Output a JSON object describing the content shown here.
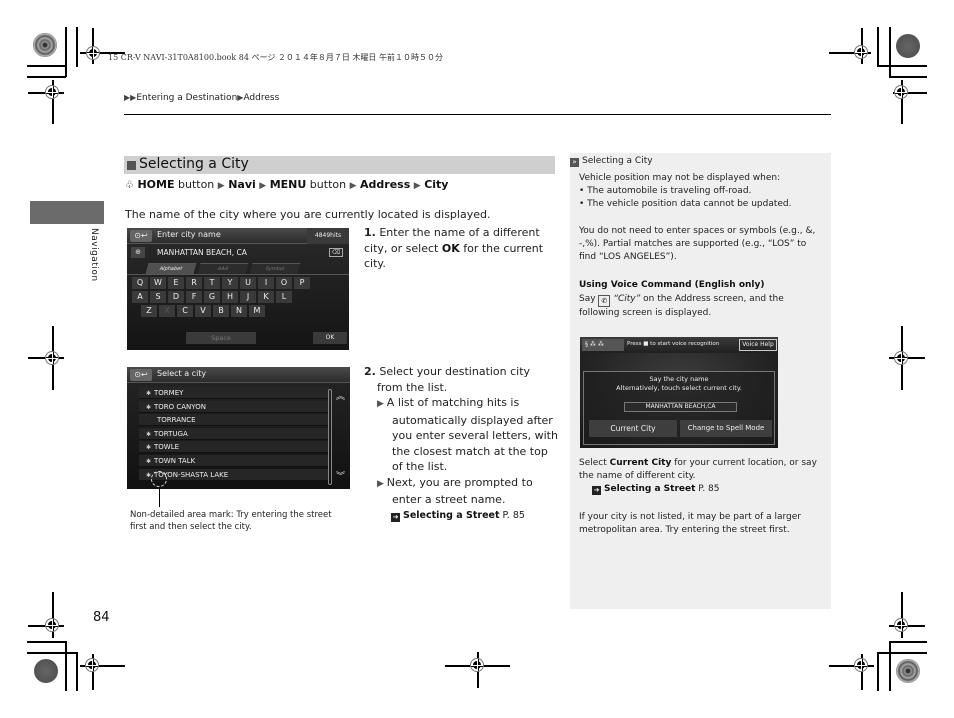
{
  "print_header": "15 CR-V NAVI-31T0A8100.book  84 ページ  ２０１４年８月７日  木曜日  午前１０時５０分",
  "breadcrumb": [
    "Entering a Destination",
    "Address"
  ],
  "side_tab_label": "Navigation",
  "section_title": "Selecting a City",
  "menu_path": [
    {
      "text": "HOME",
      "bold": true
    },
    {
      "text": " button ",
      "bold": false
    },
    {
      "text": "Navi",
      "bold": true
    },
    {
      "text": "MENU",
      "bold": true
    },
    {
      "text": " button ",
      "bold": false
    },
    {
      "text": "Address",
      "bold": true
    },
    {
      "text": "City",
      "bold": true
    }
  ],
  "intro_text": "The name of the city where you are currently located is displayed.",
  "screen_enter_city": {
    "title": "Enter city name",
    "hits": "4849hits",
    "city_value": "MANHATTAN BEACH, CA",
    "tabs": [
      "Alphabet",
      "AAA",
      "Symbol"
    ],
    "keys_row1": [
      "Q",
      "W",
      "E",
      "R",
      "T",
      "Y",
      "U",
      "I",
      "O",
      "P"
    ],
    "keys_row2": [
      "A",
      "S",
      "D",
      "F",
      "G",
      "H",
      "J",
      "K",
      "L"
    ],
    "keys_row3": [
      "Z",
      "X",
      "C",
      "V",
      "B",
      "N",
      "M"
    ],
    "space_label": "Space",
    "ok_label": "OK"
  },
  "screen_select_city": {
    "title": "Select a city",
    "items": [
      {
        "name": "TORMEY",
        "non_detailed": true
      },
      {
        "name": "TORO CANYON",
        "non_detailed": true
      },
      {
        "name": "TORRANCE",
        "non_detailed": false
      },
      {
        "name": "TORTUGA",
        "non_detailed": true
      },
      {
        "name": "TOWLE",
        "non_detailed": true
      },
      {
        "name": "TOWN TALK",
        "non_detailed": true
      },
      {
        "name": "TOYON-SHASTA LAKE",
        "non_detailed": true
      }
    ]
  },
  "caption": "Non-detailed area mark: Try entering the street first and then select the city.",
  "step1": {
    "num": "1.",
    "text_a": "Enter the name of a different city, or select ",
    "bold": "OK",
    "text_b": " for the current city."
  },
  "step2": {
    "num": "2.",
    "text": "Select your destination city from the list.",
    "bullets": [
      "A list of matching hits is automatically displayed after you enter several letters, with the closest match at the top of the list.",
      "Next, you are prompted to enter a street name."
    ],
    "ref_label": "Selecting a Street",
    "ref_page": "P. 85"
  },
  "notes": {
    "header": "Selecting a City",
    "p1": "Vehicle position may not be displayed when:",
    "bullets": [
      "The automobile is traveling off-road.",
      "The vehicle position data cannot be updated."
    ],
    "p2": "You do not need to enter spaces or symbols (e.g., &, -,%). Partial matches are supported (e.g., “LOS” to find “LOS ANGELES”).",
    "voice_heading": "Using Voice Command (English only)",
    "voice_say": "Say",
    "voice_city": "“City”",
    "voice_rest": " on the Address screen, and the following screen is displayed.",
    "p3_a": "Select ",
    "p3_bold": "Current City",
    "p3_b": " for your current location, or say the name of different city.",
    "ref_label": "Selecting a Street",
    "ref_page": "P. 85",
    "p4": "If your city is not listed, it may be part of a larger metropolitan area. Try entering the street first."
  },
  "screen_voice": {
    "press_text": "Press ■ to start voice recognition",
    "voice_help": "Voice Help",
    "line1": "Say the city name",
    "line2": "Alternatively, touch select current city.",
    "city_value": "MANHATTAN BEACH,CA",
    "current_city": "Current City",
    "spell_mode": "Change to Spell Mode"
  },
  "page_number": "84"
}
